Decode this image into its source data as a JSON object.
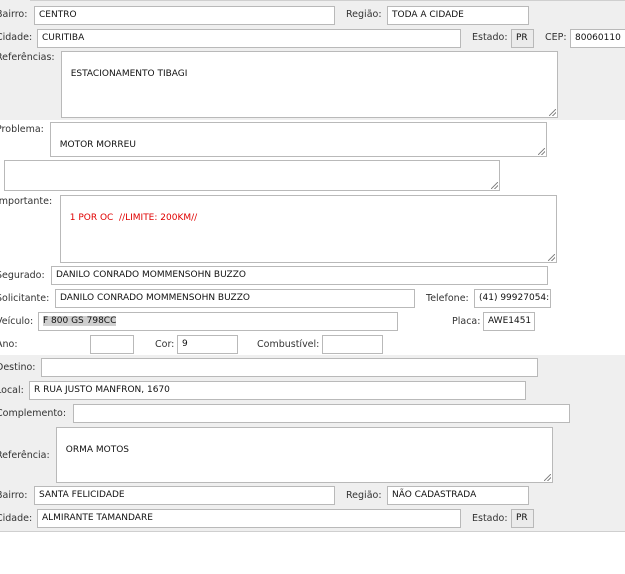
{
  "section1": {
    "bairro": {
      "label": "Bairro:",
      "value": "CENTRO"
    },
    "regiao": {
      "label": "Região:",
      "value": "TODA A CIDADE"
    },
    "cidade": {
      "label": "Cidade:",
      "value": "CURITIBA"
    },
    "estado": {
      "label": "Estado:",
      "value": "PR"
    },
    "cep": {
      "label": "CEP:",
      "value": "80060110"
    },
    "referencias": {
      "label": "Referências:",
      "value": "ESTACIONAMENTO TIBAGI"
    }
  },
  "section2": {
    "problema": {
      "label": "Problema:",
      "value": "MOTOR MORREU"
    },
    "extra_text": "",
    "importante": {
      "label": "Importante:",
      "value": "1 POR OC  //LIMITE: 200KM//"
    },
    "segurado": {
      "label": "Segurado:",
      "value": "DANILO CONRADO MOMMENSOHN BUZZO"
    },
    "solicitante": {
      "label": "Solicitante:",
      "value": "DANILO CONRADO MOMMENSOHN BUZZO"
    },
    "telefone": {
      "label": "Telefone:",
      "value": "(41) 99927054:"
    },
    "veiculo": {
      "label": "Veículo:",
      "value": "F 800 GS 798CC"
    },
    "placa": {
      "label": "Placa:",
      "value": "AWE1451"
    },
    "ano": {
      "label": "Ano:",
      "value": ""
    },
    "cor": {
      "label": "Cor:",
      "value": "9"
    },
    "combustivel": {
      "label": "Combustível:",
      "value": ""
    }
  },
  "section3": {
    "destino": {
      "label": "Destino:",
      "value": ""
    },
    "local": {
      "label": "Local:",
      "value": "R RUA JUSTO MANFRON, 1670"
    },
    "complemento": {
      "label": "Complemento:",
      "value": ""
    },
    "referencia": {
      "label": "Referência:",
      "value": "ORMA MOTOS"
    },
    "bairro": {
      "label": "Bairro:",
      "value": "SANTA FELICIDADE"
    },
    "regiao": {
      "label": "Região:",
      "value": "NÃO CADASTRADA"
    },
    "cidade": {
      "label": "Cidade:",
      "value": "ALMIRANTE TAMANDARE"
    },
    "estado": {
      "label": "Estado:",
      "value": "PR"
    }
  }
}
